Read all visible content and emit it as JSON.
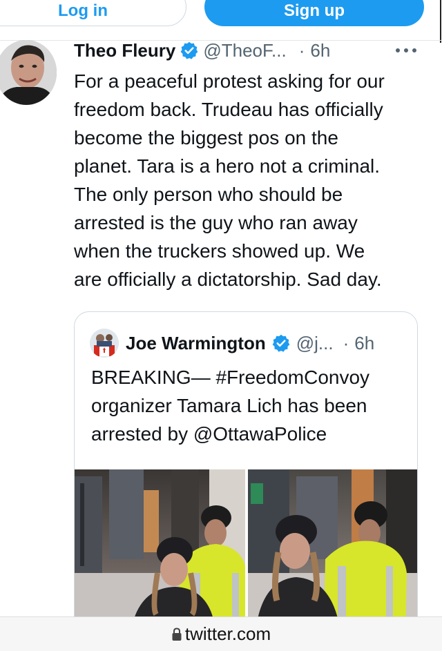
{
  "auth": {
    "login_label": "Log in",
    "signup_label": "Sign up"
  },
  "tweet": {
    "author_name": "Theo Fleury",
    "handle": "@TheoF...",
    "separator": "·",
    "time": "6h",
    "more_icon": "more-horizontal-icon",
    "verified_icon": "verified-badge-icon",
    "text": "For a peaceful protest asking for our\nfreedom back. Trudeau has officially\nbecome the biggest pos on the\nplanet. Tara is a hero not a criminal.\nThe only person who should be\narrested is the guy who ran away\nwhen the truckers showed up. We\nare officially a dictatorship. Sad day."
  },
  "quoted_tweet": {
    "author_name": "Joe Warmington",
    "handle": "@j...",
    "separator": "·",
    "time": "6h",
    "verified_icon": "verified-badge-icon",
    "text": "BREAKING— #FreedomConvoy\norganizer Tamara Lich has been\narrested by @OttawaPolice",
    "media_count": 2
  },
  "browser": {
    "url": "twitter.com",
    "lock_icon": "lock-icon"
  },
  "colors": {
    "accent": "#1d9bf0",
    "text_primary": "#0f1419",
    "text_secondary": "#536471",
    "border": "#cfd9de",
    "police_vest": "#d7e62a"
  }
}
